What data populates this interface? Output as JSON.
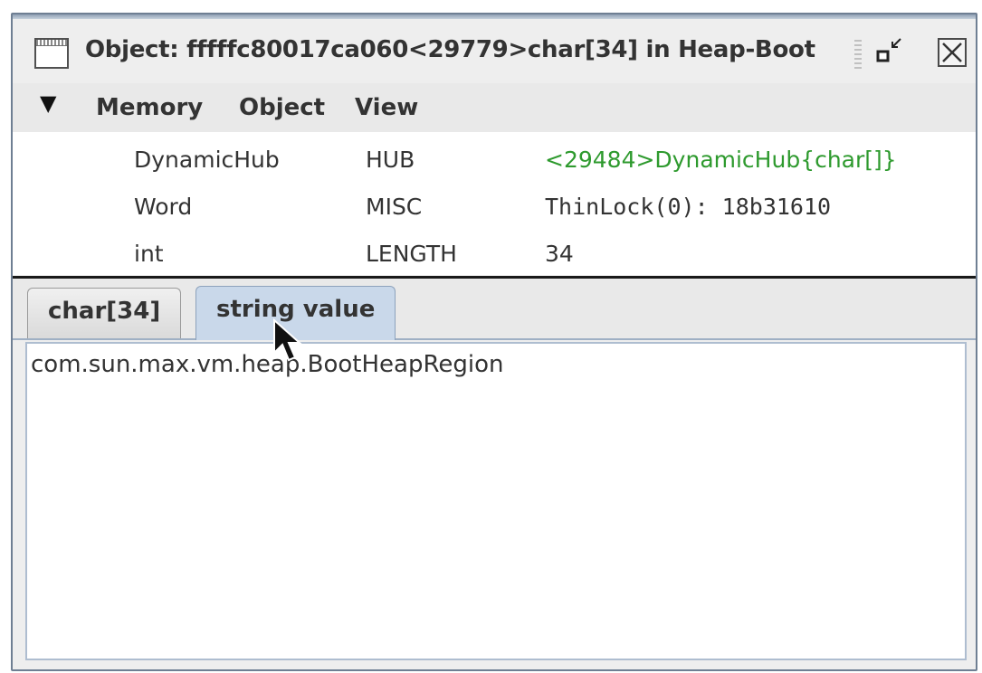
{
  "window": {
    "title": "Object: fffffc80017ca060<29779>char[34] in Heap-Boot"
  },
  "menu": {
    "items": [
      "Memory",
      "Object",
      "View"
    ]
  },
  "fields": [
    {
      "type": "DynamicHub",
      "name": "HUB",
      "value": "<29484>DynamicHub{char[]}",
      "value_color": "#2e9a2e"
    },
    {
      "type": "Word",
      "name": "MISC",
      "value": "ThinLock(0): 18b31610",
      "value_color": "#333333"
    },
    {
      "type": "int",
      "name": "LENGTH",
      "value": "34",
      "value_color": "#333333"
    }
  ],
  "tabs": [
    {
      "label": "char[34]",
      "selected": false
    },
    {
      "label": "string value",
      "selected": true
    }
  ],
  "content": {
    "text": "com.sun.max.vm.heap.BootHeapRegion"
  },
  "colors": {
    "accent": "#c9d8ea",
    "link_green": "#2e9a2e",
    "frame_border": "#6f7f93"
  },
  "icons": {
    "window": "document-icon",
    "minimize": "minimize-icon",
    "close": "close-icon",
    "menu": "triangle-down-icon",
    "pointer": "mouse-cursor-icon"
  }
}
